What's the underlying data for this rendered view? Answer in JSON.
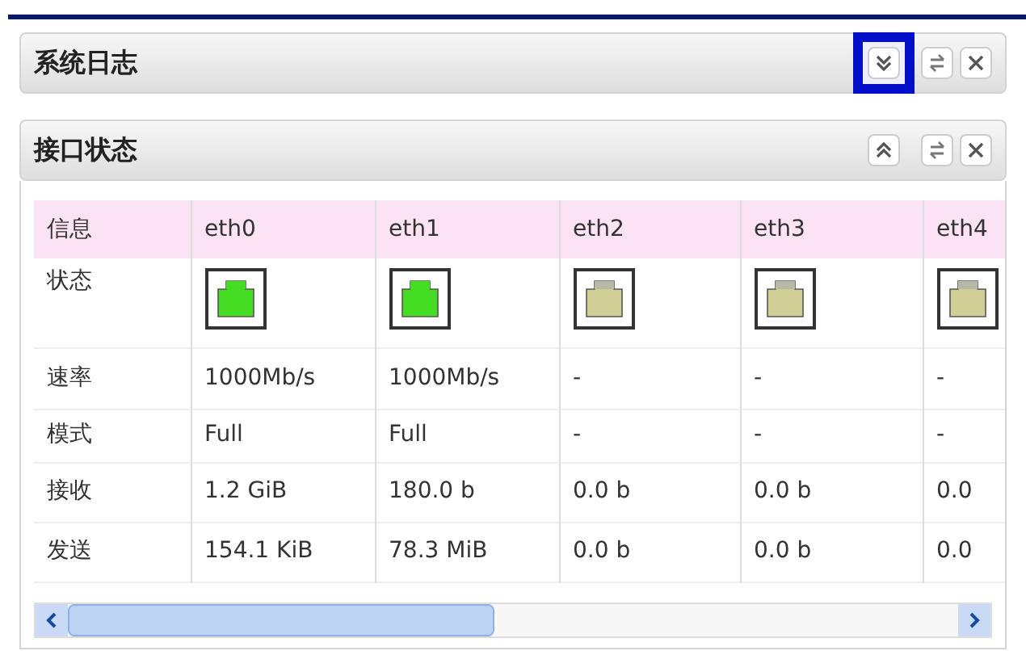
{
  "panels": [
    {
      "title": "系统日志",
      "expanded": false,
      "highlighted": true
    },
    {
      "title": "接口状态",
      "expanded": true,
      "highlighted": false
    }
  ],
  "table": {
    "row_labels": [
      "信息",
      "状态",
      "速率",
      "模式",
      "接收",
      "发送"
    ],
    "columns": [
      {
        "name": "eth0",
        "connected": true,
        "speed": "1000Mb/s",
        "mode": "Full",
        "received": "1.2 GiB",
        "sent": "154.1 KiB"
      },
      {
        "name": "eth1",
        "connected": true,
        "speed": "1000Mb/s",
        "mode": "Full",
        "received": "180.0 b",
        "sent": "78.3 MiB"
      },
      {
        "name": "eth2",
        "connected": false,
        "speed": "-",
        "mode": "-",
        "received": "0.0 b",
        "sent": "0.0 b"
      },
      {
        "name": "eth3",
        "connected": false,
        "speed": "-",
        "mode": "-",
        "received": "0.0 b",
        "sent": "0.0 b"
      },
      {
        "name": "eth4",
        "connected": false,
        "speed": "-",
        "mode": "-",
        "received": "0.0",
        "sent": "0.0"
      }
    ]
  }
}
